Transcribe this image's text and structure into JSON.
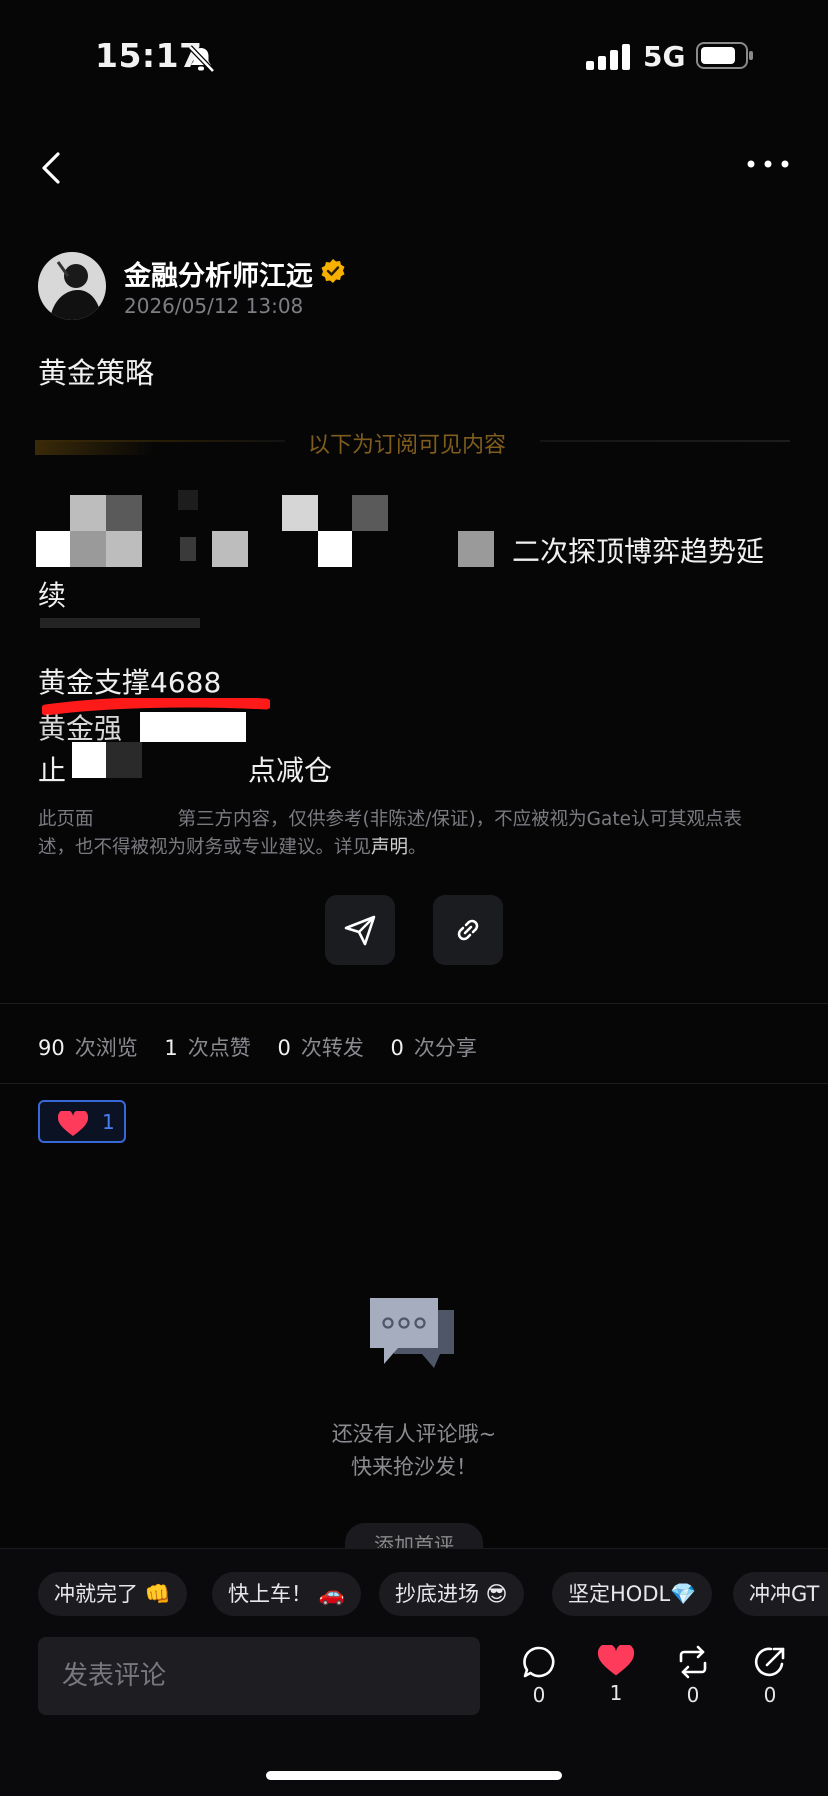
{
  "status_bar": {
    "time": "15:17",
    "network": "5G"
  },
  "colors": {
    "accent_blue": "#3768d6",
    "gold": "#7f5d1f",
    "heart": "#ff3b5c"
  },
  "post": {
    "author": "金融分析师江远",
    "date": "2026/05/12 13:08",
    "title": "黄金策略",
    "subscription_divider": "以下为订阅可见内容",
    "lines": {
      "line2_tail": "二次探顶博弈趋势延",
      "line2_cont": "续",
      "support": "黄金支撑4688",
      "strong_partial": "黄金强",
      "stop_partial_a": "止",
      "stop_partial_b": "点减仓"
    },
    "disclaimer_pre": "此页面",
    "disclaimer_mid": "第三方内容，仅供参考(非陈述/保证)，不应被视为Gate认可其观点表述，也不得被视为财务或专业建议。详见",
    "disclaimer_link": "声明",
    "disclaimer_end": "。"
  },
  "stats": {
    "views": "90",
    "views_label": "次浏览",
    "likes": "1",
    "likes_label": "次点赞",
    "reposts": "0",
    "reposts_label": "次转发",
    "shares": "0",
    "shares_label": "次分享"
  },
  "reaction": {
    "icon": "heart-icon",
    "count": "1"
  },
  "empty_state": {
    "line1": "还没有人评论哦~",
    "line2": "快来抢沙发！",
    "button_peek": "添加首评"
  },
  "quick_replies": [
    "冲就完了 👊",
    "快上车！ 🚗",
    "抄底进场 😎",
    "坚定HODL💎",
    "冲冲GT"
  ],
  "comment_placeholder": "发表评论",
  "actions": {
    "comment": "0",
    "like": "1",
    "repost": "0",
    "share": "0"
  }
}
